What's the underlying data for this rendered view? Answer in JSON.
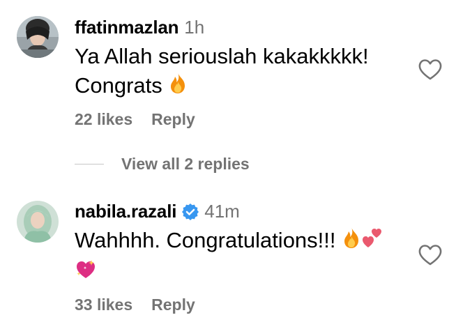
{
  "comments": [
    {
      "username": "ffatinmazlan",
      "time": "1h",
      "verified": false,
      "text": "Ya Allah seriouslah kakakkkkk! Congrats",
      "emojis": [
        "fire"
      ],
      "likes": "22 likes",
      "reply": "Reply",
      "avatar_icon": "avatar-photo-dark-hair"
    },
    {
      "username": "nabila.razali",
      "time": "41m",
      "verified": true,
      "text": "Wahhhh. Congratulations!!!",
      "emojis": [
        "fire",
        "two-hearts",
        "sparkling-heart"
      ],
      "likes": "33 likes",
      "reply": "Reply",
      "avatar_icon": "avatar-photo-hijab"
    }
  ],
  "view_replies": {
    "label": "View all 2 replies"
  },
  "colors": {
    "secondary_text": "#737373",
    "verified_badge": "#3897f0",
    "heart_outline": "#737373"
  }
}
